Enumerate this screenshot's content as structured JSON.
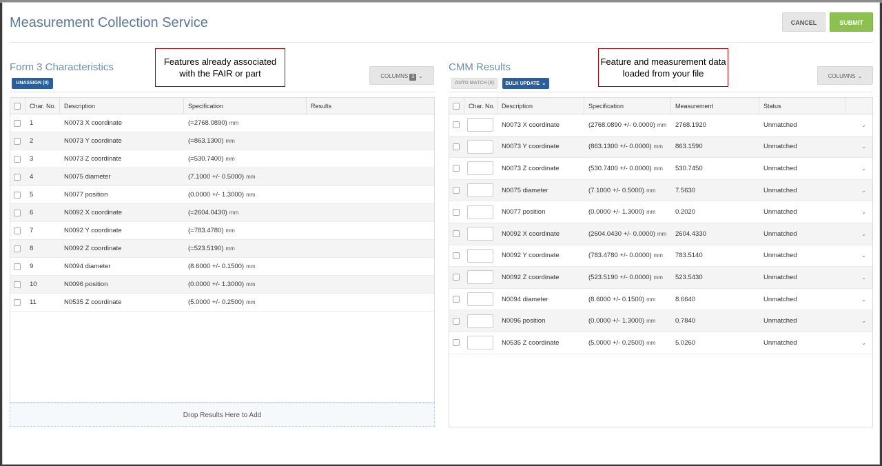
{
  "modal": {
    "title": "Measurement Collection Service",
    "cancel_label": "CANCEL",
    "submit_label": "SUBMIT"
  },
  "left_panel": {
    "title": "Form 3 Characteristics",
    "unassign_label": "UNASSIGN (0)",
    "columns_label": "COLUMNS",
    "columns_badge": "3",
    "callout": "Features already associated with the FAIR or part",
    "headers": [
      "Char. No.",
      "Description",
      "Specification",
      "Results"
    ],
    "rows": [
      {
        "no": "1",
        "desc": "N0073 X coordinate",
        "spec": "(=2768.0890)",
        "unit": "mm"
      },
      {
        "no": "2",
        "desc": "N0073 Y coordinate",
        "spec": "(=863.1300)",
        "unit": "mm"
      },
      {
        "no": "3",
        "desc": "N0073 Z coordinate",
        "spec": "(=530.7400)",
        "unit": "mm"
      },
      {
        "no": "4",
        "desc": "N0075 diameter",
        "spec": "(7.1000 +/- 0.5000)",
        "unit": "mm"
      },
      {
        "no": "5",
        "desc": "N0077 position",
        "spec": "(0.0000 +/- 1.3000)",
        "unit": "mm"
      },
      {
        "no": "6",
        "desc": "N0092 X coordinate",
        "spec": "(=2604.0430)",
        "unit": "mm"
      },
      {
        "no": "7",
        "desc": "N0092 Y coordinate",
        "spec": "(=783.4780)",
        "unit": "mm"
      },
      {
        "no": "8",
        "desc": "N0092 Z coordinate",
        "spec": "(=523.5190)",
        "unit": "mm"
      },
      {
        "no": "9",
        "desc": "N0094 diameter",
        "spec": "(8.6000 +/- 0.1500)",
        "unit": "mm"
      },
      {
        "no": "10",
        "desc": "N0096 position",
        "spec": "(0.0000 +/- 1.3000)",
        "unit": "mm"
      },
      {
        "no": "11",
        "desc": "N0535 Z coordinate",
        "spec": "(5.0000 +/- 0.2500)",
        "unit": "mm"
      }
    ],
    "drop_zone": "Drop Results Here to Add"
  },
  "right_panel": {
    "title": "CMM Results",
    "auto_match_label": "AUTO MATCH (0)",
    "bulk_update_label": "BULK UPDATE",
    "columns_label": "COLUMNS",
    "callout": "Feature and measurement data loaded from your file",
    "headers": [
      "Char. No.",
      "Description",
      "Specification",
      "Measurement",
      "Status"
    ],
    "rows": [
      {
        "desc": "N0073 X coordinate",
        "spec": "(2768.0890 +/- 0.0000)",
        "unit": "mm",
        "meas": "2768.1920",
        "status": "Unmatched"
      },
      {
        "desc": "N0073 Y coordinate",
        "spec": "(863.1300 +/- 0.0000)",
        "unit": "mm",
        "meas": "863.1590",
        "status": "Unmatched"
      },
      {
        "desc": "N0073 Z coordinate",
        "spec": "(530.7400 +/- 0.0000)",
        "unit": "mm",
        "meas": "530.7450",
        "status": "Unmatched"
      },
      {
        "desc": "N0075 diameter",
        "spec": "(7.1000 +/- 0.5000)",
        "unit": "mm",
        "meas": "7.5630",
        "status": "Unmatched"
      },
      {
        "desc": "N0077 position",
        "spec": "(0.0000 +/- 1.3000)",
        "unit": "mm",
        "meas": "0.2020",
        "status": "Unmatched"
      },
      {
        "desc": "N0092 X coordinate",
        "spec": "(2604.0430 +/- 0.0000)",
        "unit": "mm",
        "meas": "2604.4330",
        "status": "Unmatched"
      },
      {
        "desc": "N0092 Y coordinate",
        "spec": "(783.4780 +/- 0.0000)",
        "unit": "mm",
        "meas": "783.5140",
        "status": "Unmatched"
      },
      {
        "desc": "N0092 Z coordinate",
        "spec": "(523.5190 +/- 0.0000)",
        "unit": "mm",
        "meas": "523.5430",
        "status": "Unmatched"
      },
      {
        "desc": "N0094 diameter",
        "spec": "(8.6000 +/- 0.1500)",
        "unit": "mm",
        "meas": "8.6640",
        "status": "Unmatched"
      },
      {
        "desc": "N0096 position",
        "spec": "(0.0000 +/- 1.3000)",
        "unit": "mm",
        "meas": "0.7840",
        "status": "Unmatched"
      },
      {
        "desc": "N0535 Z coordinate",
        "spec": "(5.0000 +/- 0.2500)",
        "unit": "mm",
        "meas": "5.0260",
        "status": "Unmatched"
      }
    ]
  }
}
